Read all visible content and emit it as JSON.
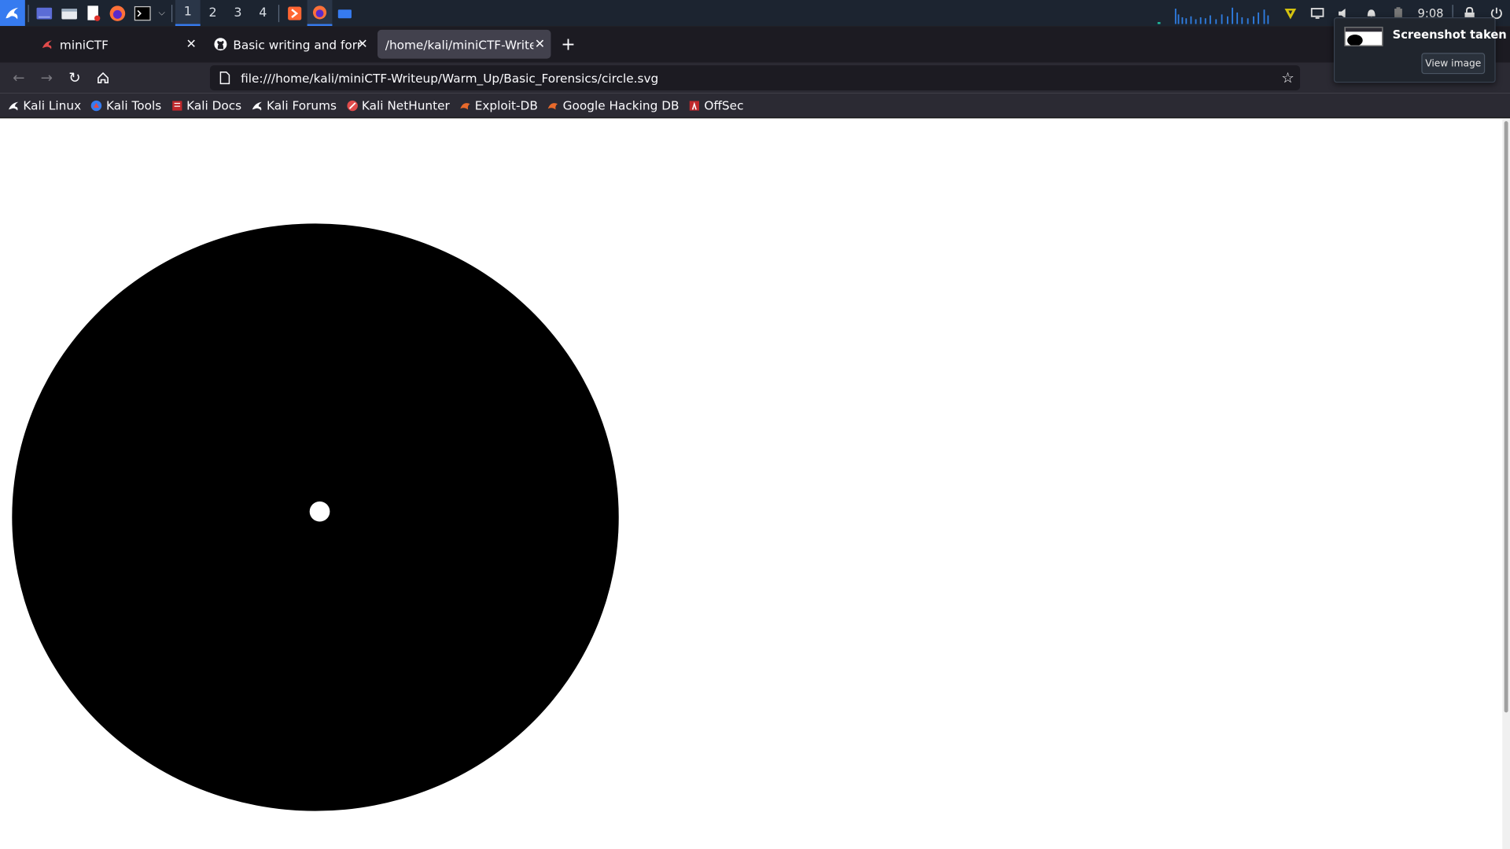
{
  "panel": {
    "workspaces": [
      "1",
      "2",
      "3",
      "4"
    ],
    "active_workspace": "1",
    "clock": "9:08"
  },
  "browser": {
    "tabs": [
      {
        "title": "miniCTF",
        "active": false
      },
      {
        "title": "Basic writing and formatti",
        "active": false
      },
      {
        "title": "/home/kali/miniCTF-Writeup",
        "active": true
      }
    ],
    "new_tab": "+",
    "url": "file:///home/kali/miniCTF-Writeup/Warm_Up/Basic_Forensics/circle.svg",
    "bookmarks": [
      {
        "label": "Kali Linux",
        "icon": "kali-dragon-icon"
      },
      {
        "label": "Kali Tools",
        "icon": "kali-tools-icon"
      },
      {
        "label": "Kali Docs",
        "icon": "kali-docs-icon"
      },
      {
        "label": "Kali Forums",
        "icon": "kali-dragon-icon"
      },
      {
        "label": "Kali NetHunter",
        "icon": "nethunter-icon"
      },
      {
        "label": "Exploit-DB",
        "icon": "exploit-db-icon"
      },
      {
        "label": "Google Hacking DB",
        "icon": "exploit-db-icon"
      },
      {
        "label": "OffSec",
        "icon": "offsec-icon"
      }
    ]
  },
  "notification": {
    "title": "Screenshot taken",
    "action": "View image"
  },
  "colors": {
    "panel_bg": "#1c2430",
    "accent": "#367bf0",
    "tab_bg": "#1c1b22",
    "toolbar_bg": "#2b2a33"
  }
}
